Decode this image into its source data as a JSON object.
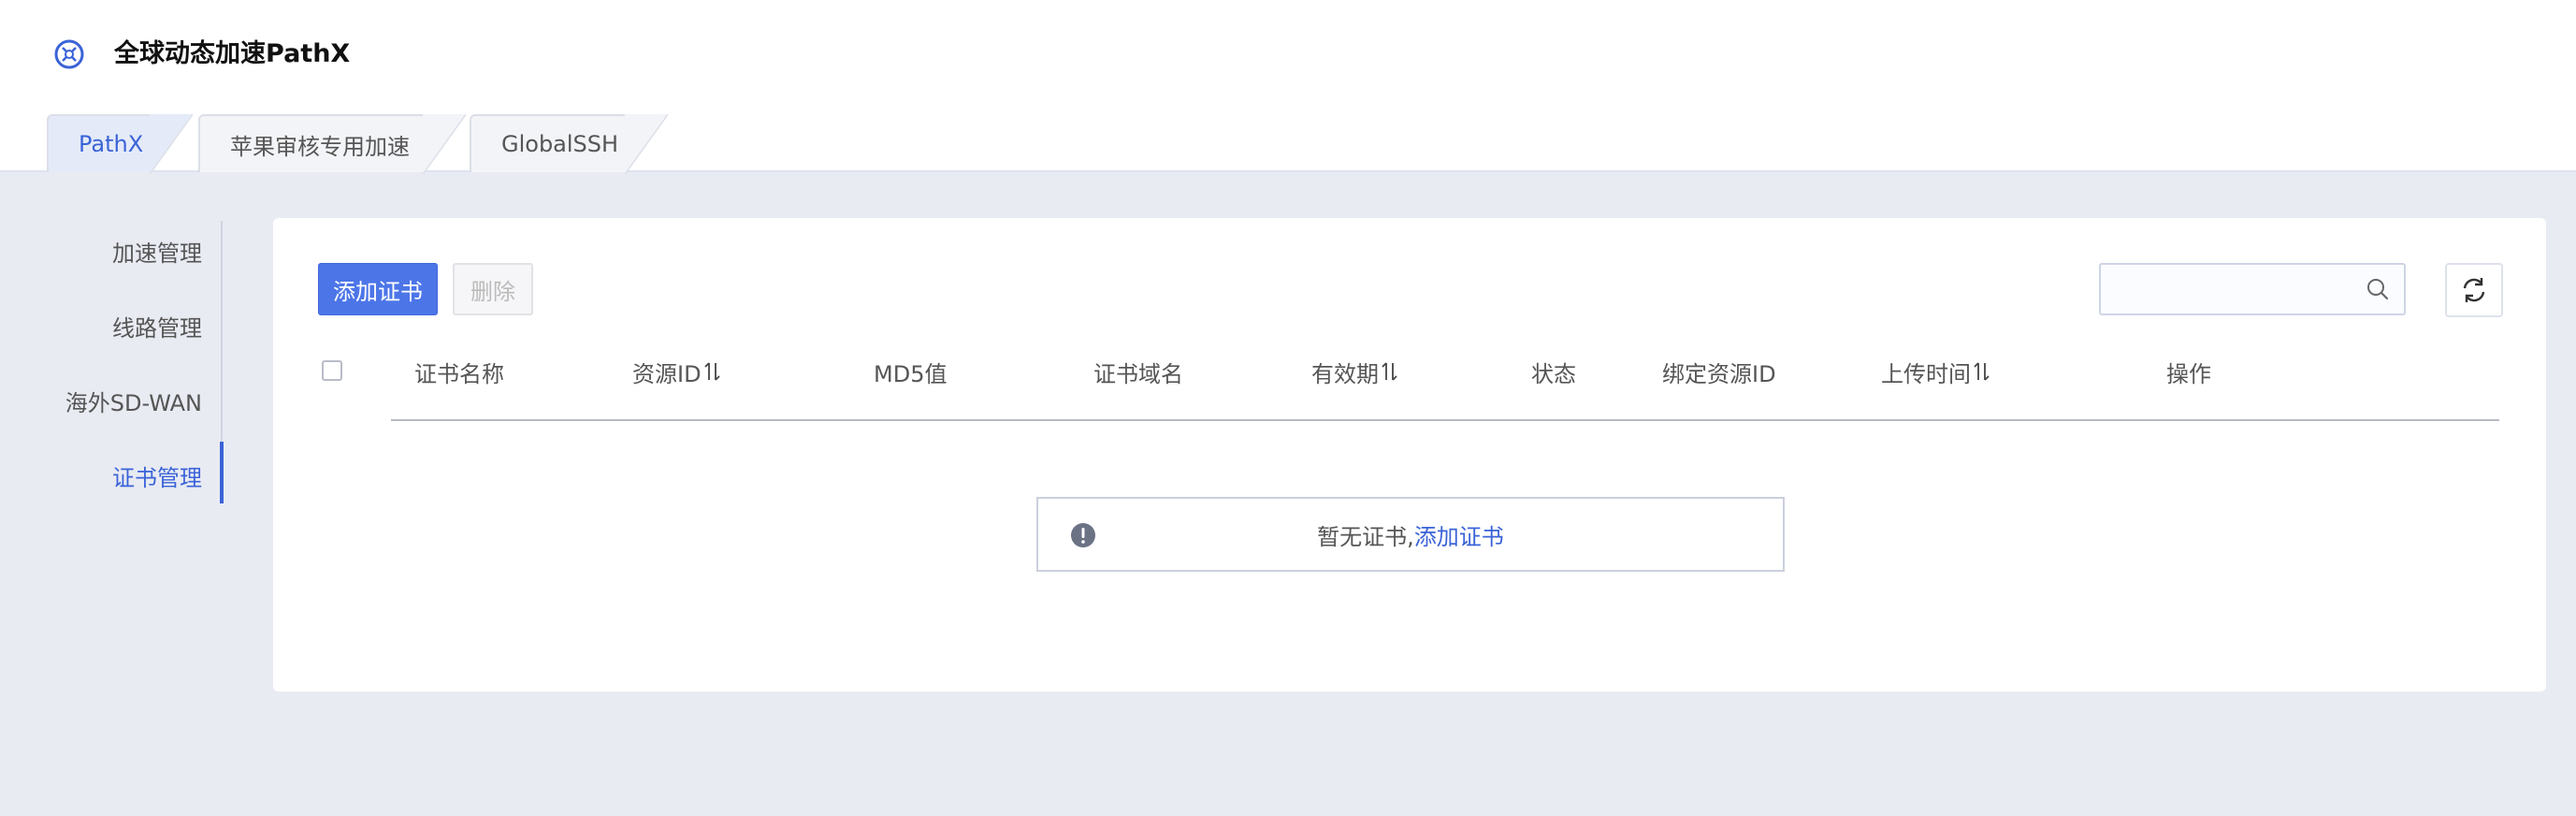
{
  "app": {
    "title": "全球动态加速PathX"
  },
  "tabs": [
    {
      "label": "PathX",
      "active": true
    },
    {
      "label": "苹果审核专用加速",
      "active": false
    },
    {
      "label": "GlobalSSH",
      "active": false
    }
  ],
  "sidebar": {
    "items": [
      {
        "label": "加速管理",
        "active": false
      },
      {
        "label": "线路管理",
        "active": false
      },
      {
        "label": "海外SD-WAN",
        "active": false
      },
      {
        "label": "证书管理",
        "active": true
      }
    ]
  },
  "toolbar": {
    "add_label": "添加证书",
    "delete_label": "删除",
    "search_value": "",
    "search_placeholder": ""
  },
  "table": {
    "columns": [
      {
        "label": "证书名称",
        "sortable": false
      },
      {
        "label": "资源ID",
        "sortable": true
      },
      {
        "label": "MD5值",
        "sortable": false
      },
      {
        "label": "证书域名",
        "sortable": false
      },
      {
        "label": "有效期",
        "sortable": true
      },
      {
        "label": "状态",
        "sortable": false
      },
      {
        "label": "绑定资源ID",
        "sortable": false
      },
      {
        "label": "上传时间",
        "sortable": true
      },
      {
        "label": "操作",
        "sortable": false
      }
    ],
    "rows": []
  },
  "empty": {
    "text": "暂无证书, ",
    "link_label": "添加证书"
  },
  "colors": {
    "accent": "#3a63d8",
    "primary_button": "#4c75e8",
    "background": "#e9ebf3"
  }
}
